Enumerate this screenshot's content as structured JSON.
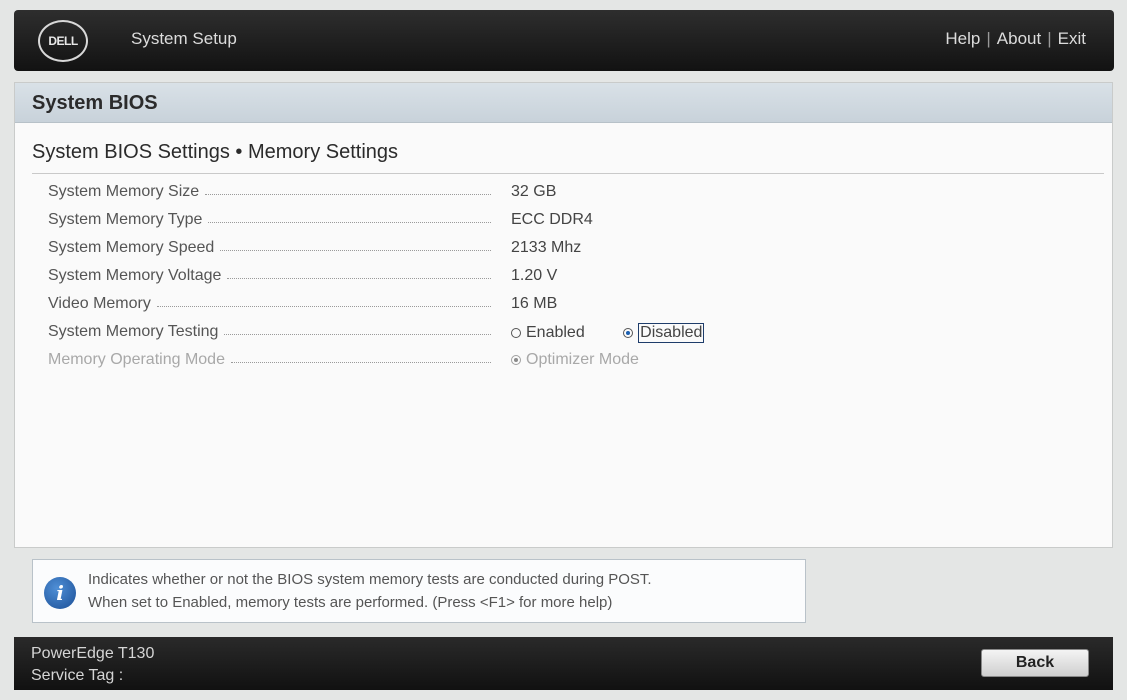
{
  "header": {
    "logo_text": "DELL",
    "app_title": "System Setup",
    "links": {
      "help": "Help",
      "about": "About",
      "exit": "Exit",
      "separator": "|"
    }
  },
  "panel": {
    "title": "System BIOS",
    "breadcrumb": "System BIOS Settings • Memory Settings",
    "rows": [
      {
        "label": "System Memory Size",
        "value": "32 GB"
      },
      {
        "label": "System Memory Type",
        "value": "ECC DDR4"
      },
      {
        "label": "System Memory Speed",
        "value": "2133 Mhz"
      },
      {
        "label": "System Memory Voltage",
        "value": "1.20 V"
      },
      {
        "label": "Video Memory",
        "value": "16 MB"
      }
    ],
    "memory_testing": {
      "label": "System Memory Testing",
      "options": [
        "Enabled",
        "Disabled"
      ],
      "selected": "Disabled"
    },
    "operating_mode": {
      "label": "Memory Operating Mode",
      "value": "Optimizer Mode",
      "disabled": true
    }
  },
  "info": {
    "line1": "Indicates whether or not the BIOS system memory tests are conducted during POST.",
    "line2": "When set to Enabled, memory tests are performed. (Press <F1> for more help)"
  },
  "footer": {
    "model": "PowerEdge T130",
    "service_tag_label": "Service Tag :",
    "back_label": "Back"
  },
  "colors": {
    "header_bg": "#1e1e1e",
    "panel_header_bg": "#cdd6dd",
    "radio_accent": "#1b5fb0",
    "info_icon": "#2a63ad"
  }
}
